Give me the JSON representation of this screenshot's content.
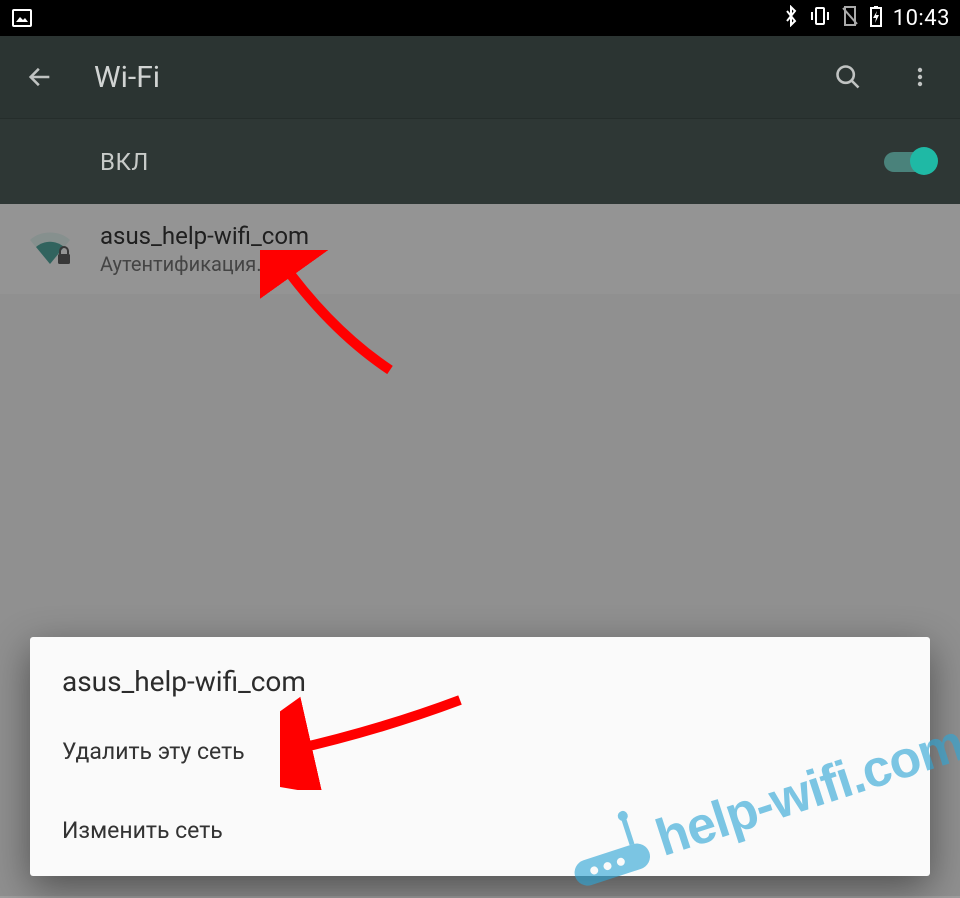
{
  "statusbar": {
    "time": "10:43"
  },
  "appbar": {
    "title": "Wi-Fi"
  },
  "wifi_toggle": {
    "label": "ВКЛ",
    "on": true
  },
  "network": {
    "ssid": "asus_help-wifi_com",
    "status": "Аутентификация…"
  },
  "dialog": {
    "title": "asus_help-wifi_com",
    "forget": "Удалить эту сеть",
    "modify": "Изменить сеть"
  },
  "watermark": {
    "text": "help-wifi.com"
  }
}
